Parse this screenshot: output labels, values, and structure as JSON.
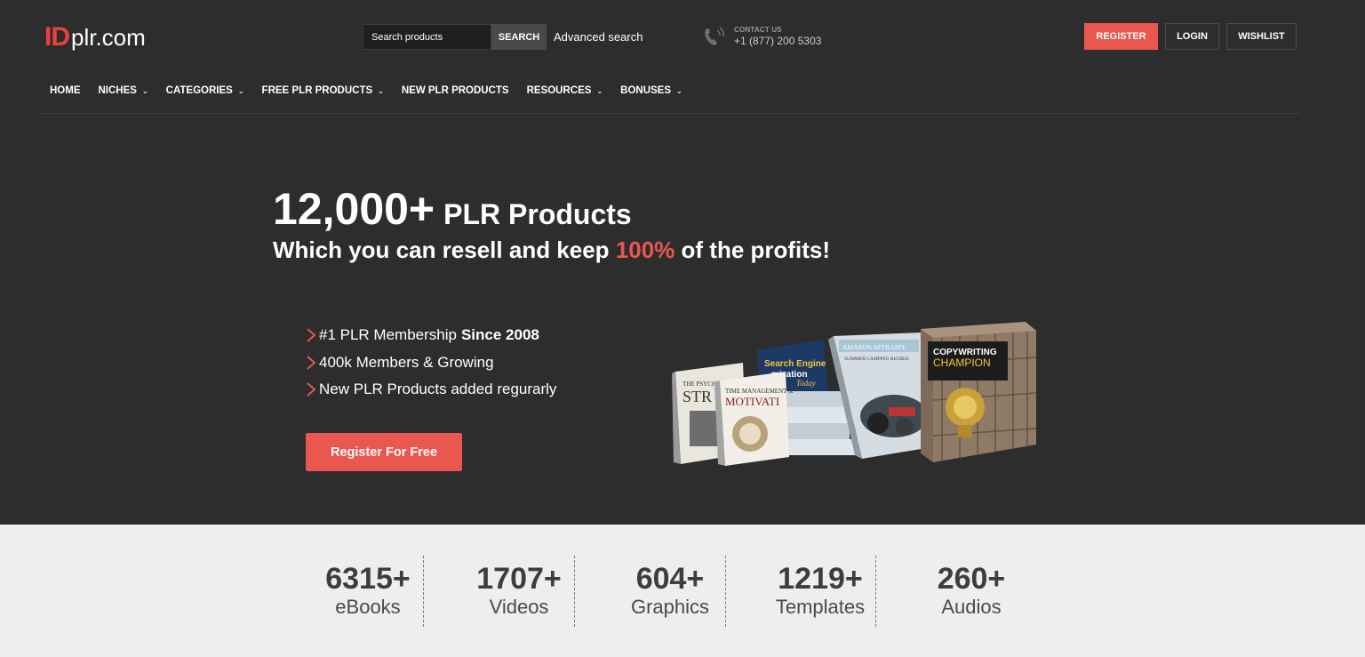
{
  "logo": {
    "id": "ID",
    "rest": "plr.com"
  },
  "search": {
    "placeholder": "Search products",
    "button": "SEARCH",
    "advanced": "Advanced search"
  },
  "contact": {
    "label": "CONTACT US",
    "phone": "+1 (877) 200 5303"
  },
  "header_buttons": {
    "register": "REGISTER",
    "login": "LOGIN",
    "wishlist": "WISHLIST"
  },
  "nav": [
    {
      "label": "HOME",
      "dropdown": false
    },
    {
      "label": "NICHES",
      "dropdown": true
    },
    {
      "label": "CATEGORIES",
      "dropdown": true
    },
    {
      "label": "FREE PLR PRODUCTS",
      "dropdown": true
    },
    {
      "label": "NEW PLR PRODUCTS",
      "dropdown": false
    },
    {
      "label": "RESOURCES",
      "dropdown": true
    },
    {
      "label": "BONUSES",
      "dropdown": true
    }
  ],
  "hero": {
    "count": "12,000+",
    "title_rest": "PLR Products",
    "sub_pre": "Which you can resell and keep ",
    "sub_highlight": "100%",
    "sub_post": " of the profits!",
    "bullets": [
      {
        "text": "#1 PLR Membership",
        "bold": "Since 2008"
      },
      {
        "text": "400k Members & Growing",
        "bold": ""
      },
      {
        "text": "New PLR Products added regurarly",
        "bold": ""
      }
    ],
    "cta": "Register For Free",
    "product_labels": {
      "psych": "THE PSYCH",
      "str": "STR",
      "time": "TIME MANAGEMENT &",
      "motiv": "MOTIVATI",
      "seo1": "Search Engine",
      "seo2": "mization",
      "seo3": "Today",
      "amazon": "AMAZON AFFILIATE",
      "amazon_sub": "SUMMER CAMPING RICHES!",
      "copy1": "COPYWRITING",
      "copy2": "CHAMPION"
    }
  },
  "stats": [
    {
      "number": "6315+",
      "label": "eBooks"
    },
    {
      "number": "1707+",
      "label": "Videos"
    },
    {
      "number": "604+",
      "label": "Graphics"
    },
    {
      "number": "1219+",
      "label": "Templates"
    },
    {
      "number": "260+",
      "label": "Audios"
    }
  ],
  "colors": {
    "accent": "#e9574f",
    "header_bg": "#2d2d2d",
    "stats_bg": "#eeeeee"
  }
}
